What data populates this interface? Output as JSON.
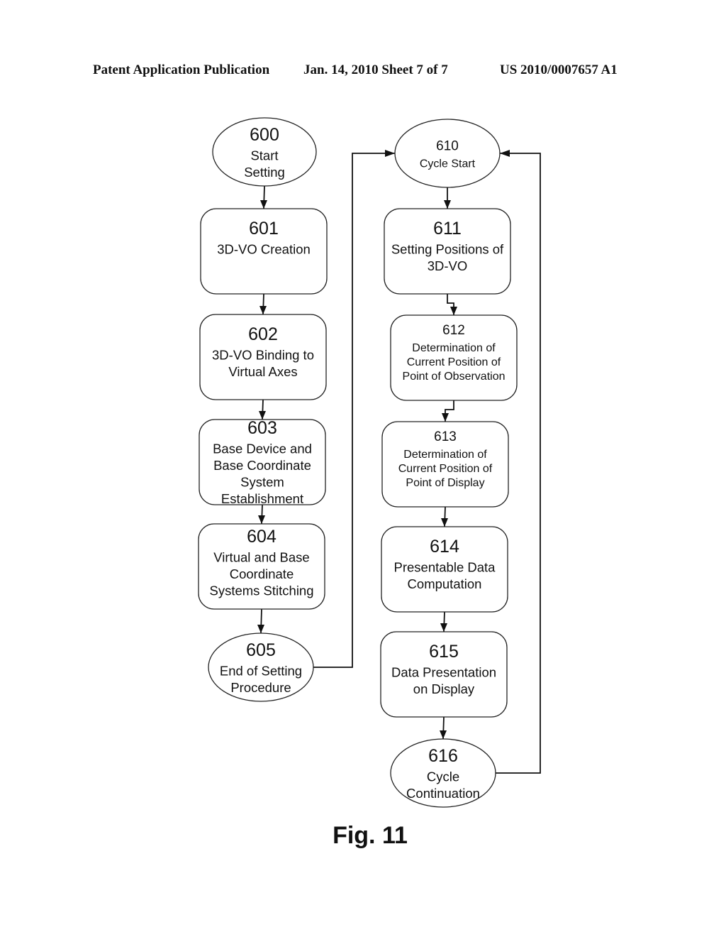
{
  "header": {
    "left": "Patent Application Publication",
    "center": "Jan. 14, 2010  Sheet 7 of 7",
    "right": "US 2010/0007657 A1"
  },
  "figure_label": "Fig. 11",
  "nodes": [
    {
      "id": "600",
      "shape": "ellipse",
      "lines": [
        "600",
        "Start",
        "Setting"
      ]
    },
    {
      "id": "601",
      "shape": "rounded-rect",
      "lines": [
        "601",
        "3D-VO Creation"
      ]
    },
    {
      "id": "602",
      "shape": "rounded-rect",
      "lines": [
        "602",
        "3D-VO Binding to",
        "Virtual Axes"
      ]
    },
    {
      "id": "603",
      "shape": "rounded-rect",
      "lines": [
        "603",
        "Base Device and",
        "Base Coordinate",
        "System",
        "Establishment"
      ]
    },
    {
      "id": "604",
      "shape": "rounded-rect",
      "lines": [
        "604",
        "Virtual and Base",
        "Coordinate",
        "Systems Stitching"
      ]
    },
    {
      "id": "605",
      "shape": "ellipse",
      "lines": [
        "605",
        "End of Setting",
        "Procedure"
      ]
    },
    {
      "id": "610",
      "shape": "ellipse",
      "lines": [
        "610",
        "Cycle Start"
      ]
    },
    {
      "id": "611",
      "shape": "rounded-rect",
      "lines": [
        "611",
        "Setting Positions of",
        "3D-VO"
      ]
    },
    {
      "id": "612",
      "shape": "rounded-rect",
      "lines": [
        "612",
        "Determination of",
        "Current Position of",
        "Point of Observation"
      ]
    },
    {
      "id": "613",
      "shape": "rounded-rect",
      "lines": [
        "613",
        "Determination of",
        "Current Position of",
        "Point of Display"
      ]
    },
    {
      "id": "614",
      "shape": "rounded-rect",
      "lines": [
        "614",
        "Presentable Data",
        "Computation"
      ]
    },
    {
      "id": "615",
      "shape": "rounded-rect",
      "lines": [
        "615",
        "Data Presentation",
        "on Display"
      ]
    },
    {
      "id": "616",
      "shape": "ellipse",
      "lines": [
        "616",
        "Cycle",
        "Continuation"
      ]
    }
  ],
  "edges": [
    {
      "from": "600",
      "to": "601"
    },
    {
      "from": "601",
      "to": "602"
    },
    {
      "from": "602",
      "to": "603"
    },
    {
      "from": "603",
      "to": "604"
    },
    {
      "from": "604",
      "to": "605"
    },
    {
      "from": "605",
      "to": "610"
    },
    {
      "from": "610",
      "to": "611"
    },
    {
      "from": "611",
      "to": "612"
    },
    {
      "from": "612",
      "to": "613"
    },
    {
      "from": "613",
      "to": "614"
    },
    {
      "from": "614",
      "to": "615"
    },
    {
      "from": "615",
      "to": "616"
    },
    {
      "from": "616",
      "to": "610"
    }
  ]
}
